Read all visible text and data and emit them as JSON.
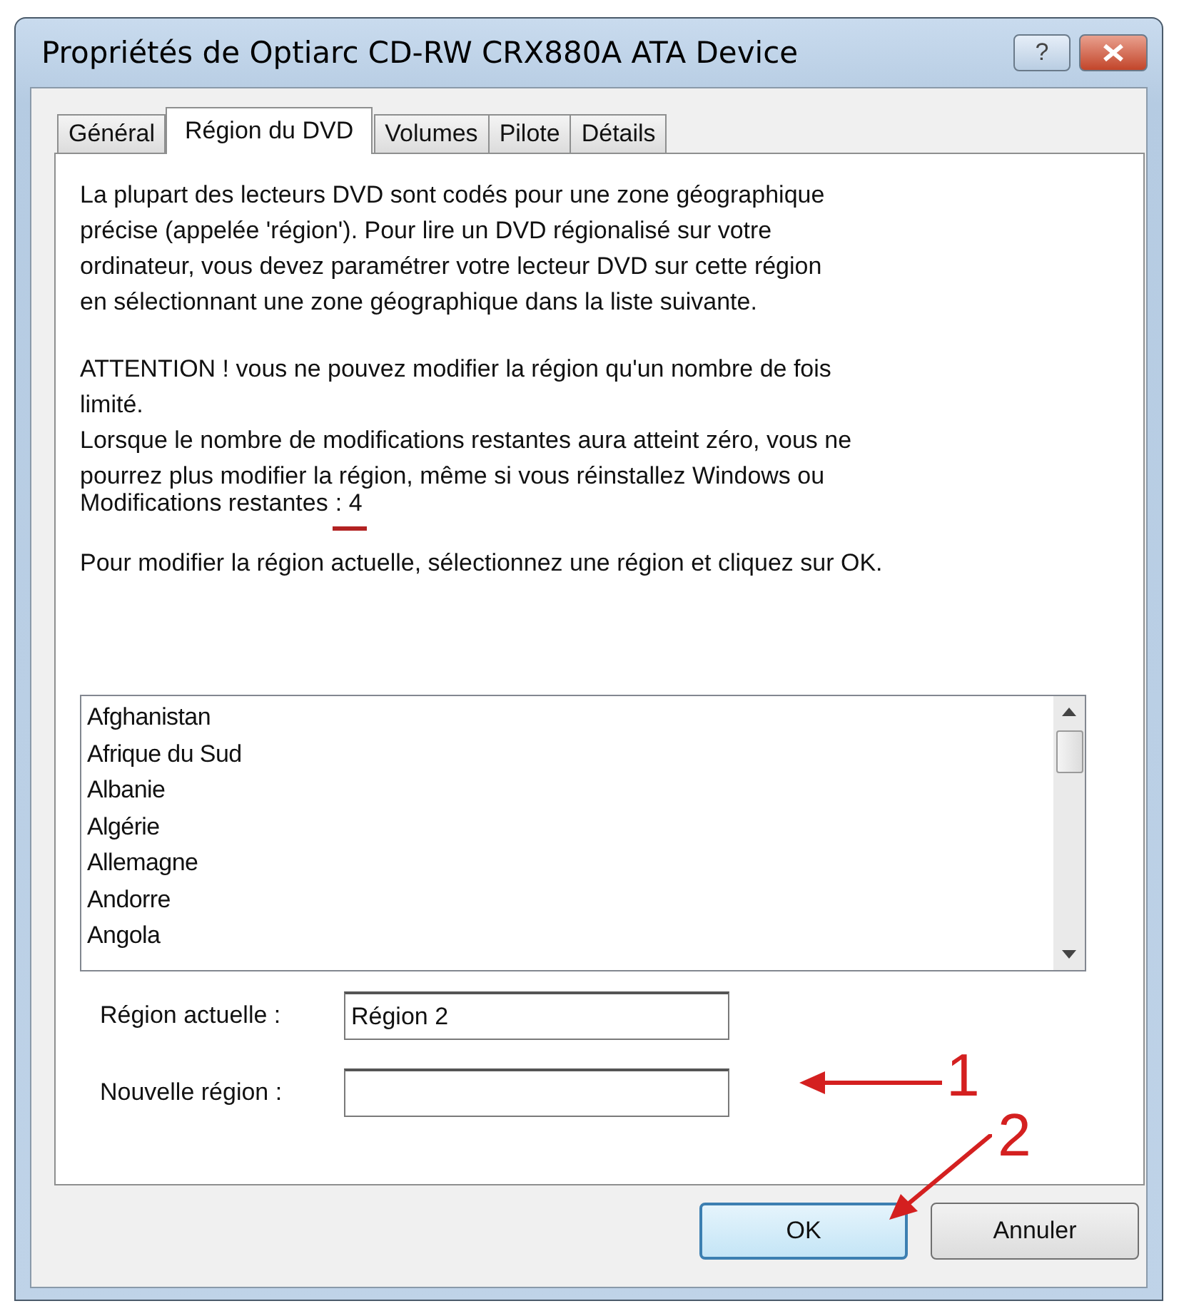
{
  "window": {
    "title": "Propriétés de Optiarc CD-RW CRX880A ATA Device",
    "help_button": "?"
  },
  "tabs": [
    {
      "label": "Général",
      "selected": false
    },
    {
      "label": "Région du DVD",
      "selected": true
    },
    {
      "label": "Volumes",
      "selected": false
    },
    {
      "label": "Pilote",
      "selected": false
    },
    {
      "label": "Détails",
      "selected": false
    }
  ],
  "intro": [
    "La plupart des lecteurs DVD sont codés pour une zone géographique",
    "précise (appelée 'région'). Pour lire un DVD régionalisé sur votre",
    "ordinateur, vous devez paramétrer votre lecteur DVD sur cette région",
    "en sélectionnant une zone géographique dans la liste suivante."
  ],
  "warning": [
    "ATTENTION ! vous ne pouvez modifier la région qu'un nombre de fois",
    "limité.",
    "Lorsque le nombre de modifications restantes aura atteint zéro, vous ne",
    "pourrez plus modifier la région, même si vous réinstallez Windows ou"
  ],
  "remaining": {
    "label": "Modifications restantes",
    "value": ": 4"
  },
  "instruction": "Pour modifier la région actuelle, sélectionnez une région et cliquez sur OK.",
  "regions": [
    "Afghanistan",
    "Afrique du Sud",
    "Albanie",
    "Algérie",
    "Allemagne",
    "Andorre",
    "Angola"
  ],
  "fields": [
    {
      "label": "Région actuelle :",
      "value": "Région 2"
    },
    {
      "label": "Nouvelle région :"
    }
  ],
  "buttons": [
    {
      "label": "OK",
      "default": true
    },
    {
      "label": "Annuler",
      "default": false
    }
  ],
  "annotations": [
    {
      "kind": "underline"
    },
    {
      "kind": "arrow-left",
      "label": "1"
    },
    {
      "kind": "arrow-diagonal",
      "label": "2"
    }
  ]
}
